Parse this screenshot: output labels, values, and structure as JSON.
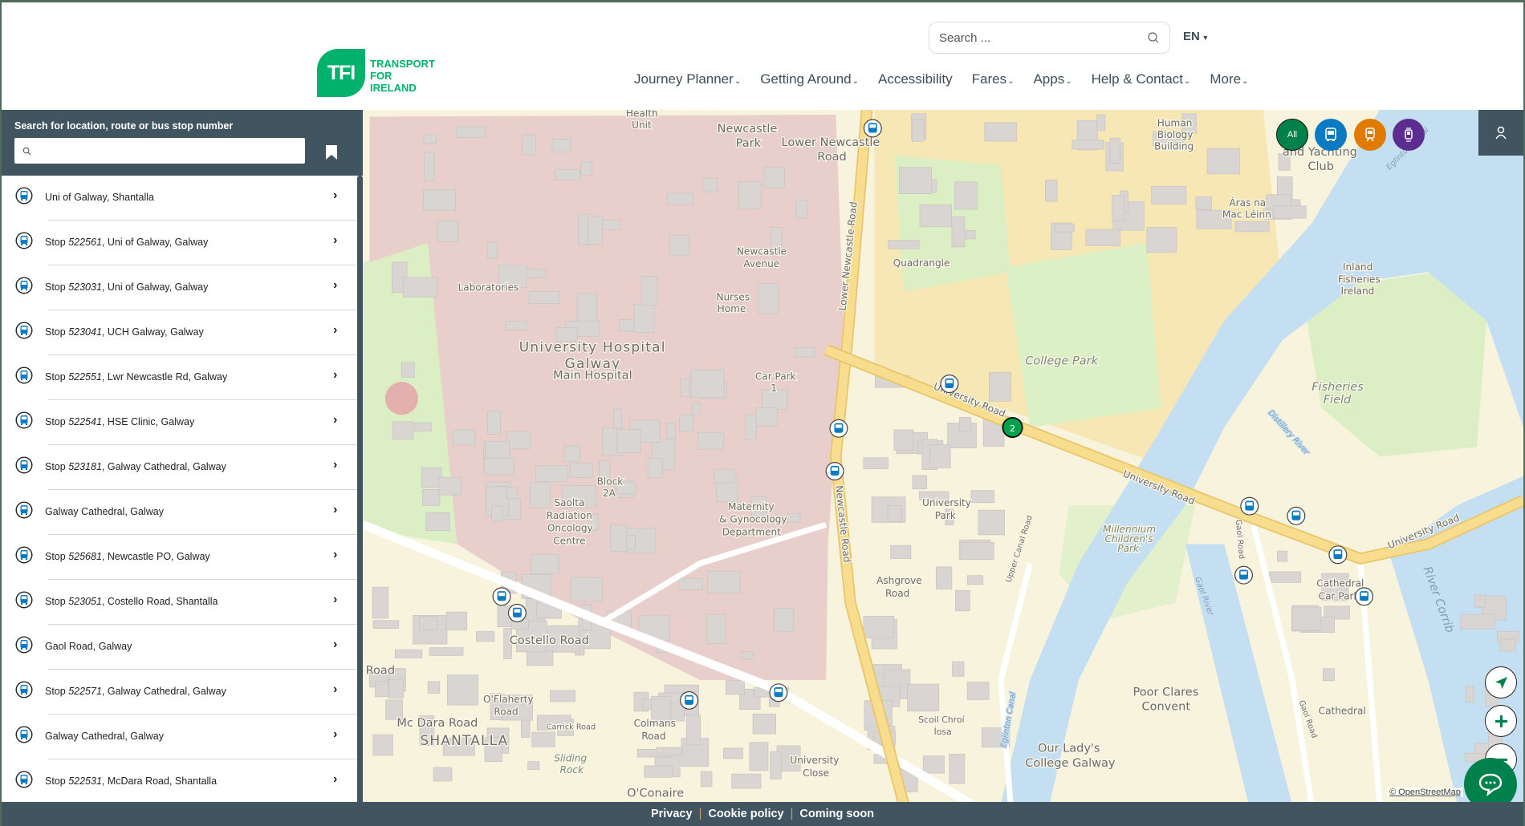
{
  "header": {
    "logo": {
      "mark": "TFI",
      "line1": "TRANSPORT",
      "line2": "FOR",
      "line3": "IRELAND"
    },
    "search_placeholder": "Search ...",
    "language": "EN",
    "nav": [
      {
        "label": "Journey Planner",
        "dropdown": true
      },
      {
        "label": "Getting Around",
        "dropdown": true
      },
      {
        "label": "Accessibility",
        "dropdown": false
      },
      {
        "label": "Fares",
        "dropdown": true
      },
      {
        "label": "Apps",
        "dropdown": true
      },
      {
        "label": "Help & Contact",
        "dropdown": true
      },
      {
        "label": "More",
        "dropdown": true
      }
    ]
  },
  "sidebar": {
    "search_title": "Search for location, route or bus stop number",
    "search_value": "",
    "results": [
      {
        "prefix": "",
        "number": "",
        "suffix": "Uni of Galway, Shantalla"
      },
      {
        "prefix": "Stop ",
        "number": "522561",
        "suffix": ", Uni of Galway, Galway"
      },
      {
        "prefix": "Stop ",
        "number": "523031",
        "suffix": ", Uni of Galway, Galway"
      },
      {
        "prefix": "Stop ",
        "number": "523041",
        "suffix": ", UCH Galway, Galway"
      },
      {
        "prefix": "Stop ",
        "number": "522551",
        "suffix": ", Lwr Newcastle Rd, Galway"
      },
      {
        "prefix": "Stop ",
        "number": "522541",
        "suffix": ", HSE Clinic, Galway"
      },
      {
        "prefix": "Stop ",
        "number": "523181",
        "suffix": ", Galway Cathedral, Galway"
      },
      {
        "prefix": "",
        "number": "",
        "suffix": "Galway Cathedral, Galway"
      },
      {
        "prefix": "Stop ",
        "number": "525681",
        "suffix": ", Newcastle PO, Galway"
      },
      {
        "prefix": "Stop ",
        "number": "523051",
        "suffix": ", Costello Road, Shantalla"
      },
      {
        "prefix": "",
        "number": "",
        "suffix": "Gaol Road, Galway"
      },
      {
        "prefix": "Stop ",
        "number": "522571",
        "suffix": ", Galway Cathedral, Galway"
      },
      {
        "prefix": "",
        "number": "",
        "suffix": "Galway Cathedral, Galway"
      },
      {
        "prefix": "Stop ",
        "number": "522531",
        "suffix": ", McDara Road, Shantalla"
      }
    ]
  },
  "map": {
    "modes": [
      {
        "label": "All",
        "color": "#00804a"
      },
      {
        "label": "bus-icon",
        "color": "#0a7bc2"
      },
      {
        "label": "rail-icon",
        "color": "#e07b00"
      },
      {
        "label": "tram-icon",
        "color": "#5c2d91"
      }
    ],
    "cluster_count": "2",
    "attribution": "© OpenStreetMap",
    "labels": [
      "University Hospital",
      "Galway",
      "Main Hospital",
      "College Park",
      "University Road",
      "University Road",
      "University Road",
      "Newcastle Road",
      "Lower Newcastle Road",
      "Costello Road",
      "SHANTALLA",
      "Mc Dara Road",
      "Fisheries",
      "Field",
      "Poor Clares",
      "Convent",
      "Our Lady's",
      "College Galway",
      "Cathedral",
      "Car Park",
      "Cathedral",
      "River Corrib",
      "Quadrangle",
      "Laboratories",
      "Nurses",
      "Home",
      "Car Park",
      "1",
      "Block",
      "2A",
      "Saolta",
      "Radiation",
      "Oncology",
      "Centre",
      "Maternity",
      "& Gynocology",
      "Department",
      "Ashgrove",
      "Road",
      "University",
      "Park",
      "Millennium",
      "Children's",
      "Park",
      "Newcastle",
      "Avenue",
      "Newcastle",
      "Park",
      "Lower Newcastle",
      "Road",
      "Human",
      "Biology",
      "Building",
      "Áras na",
      "Mac Léinn",
      "Inland",
      "Fisheries",
      "Ireland",
      "Health",
      "Unit",
      "O'Conaire",
      "Colmans",
      "Road",
      "Carrick Road",
      "Sliding",
      "Rock",
      "University",
      "Close",
      "Scoil Chroí",
      "Íosa",
      "Upper Canal Road",
      "Gaol Road",
      "Gaol Road",
      "Eglinton Canal",
      "O'Flaherty",
      "Road",
      "Distillery River",
      "and Yachting",
      "Club",
      "Road",
      "Gaol River",
      "Eglinton Canal"
    ]
  },
  "footer": {
    "links": [
      "Privacy",
      "Cookie policy",
      "Coming soon"
    ]
  },
  "colors": {
    "brand_green": "#00b26b",
    "dark_slate": "#40555f",
    "bus_blue": "#0a7bc2"
  }
}
